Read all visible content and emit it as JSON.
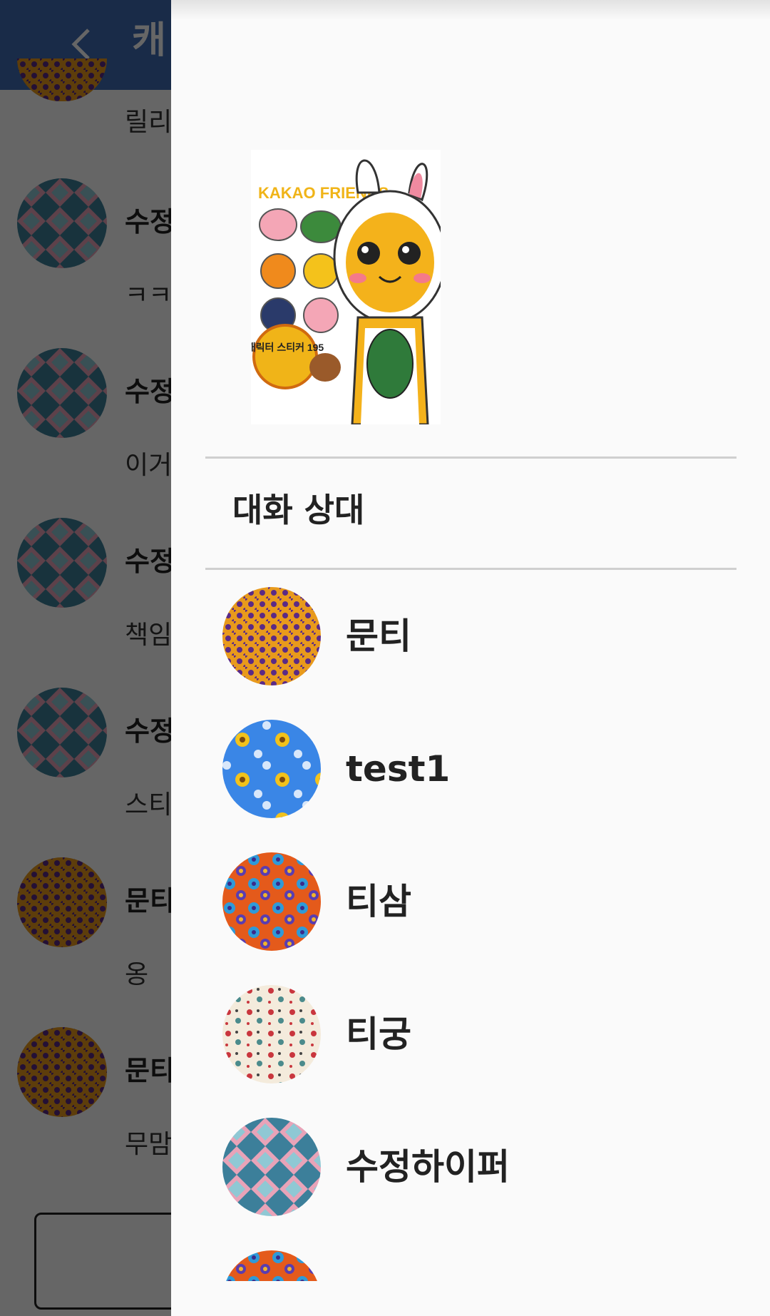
{
  "chat": {
    "title": "캐",
    "messages": [
      {
        "name": "",
        "text": "릴리"
      },
      {
        "name": "수정",
        "text": "ㅋㅋ"
      },
      {
        "name": "수정",
        "text": "이거"
      },
      {
        "name": "수정",
        "text": "책임"
      },
      {
        "name": "수정",
        "text": "스티"
      },
      {
        "name": "문티",
        "text": "옹"
      },
      {
        "name": "문티",
        "text": "무맘"
      }
    ]
  },
  "drawer": {
    "image_text": "KAKAO FRIENDS",
    "sticker_text": "캐릭터 스티커 195",
    "section_title": "대화 상대",
    "members": [
      {
        "name": "문티",
        "pattern": "orange-dots"
      },
      {
        "name": "test1",
        "pattern": "blue-flowers"
      },
      {
        "name": "티삼",
        "pattern": "colorful-flowers"
      },
      {
        "name": "티궁",
        "pattern": "cream-flowers"
      },
      {
        "name": "수정하이퍼",
        "pattern": "blue-pink-argyle"
      },
      {
        "name": "",
        "pattern": "colorful-flowers"
      }
    ]
  },
  "colors": {
    "appbar": "#3f6cb3",
    "drawer_bg": "#fafafa",
    "divider": "#cfcfcf"
  }
}
